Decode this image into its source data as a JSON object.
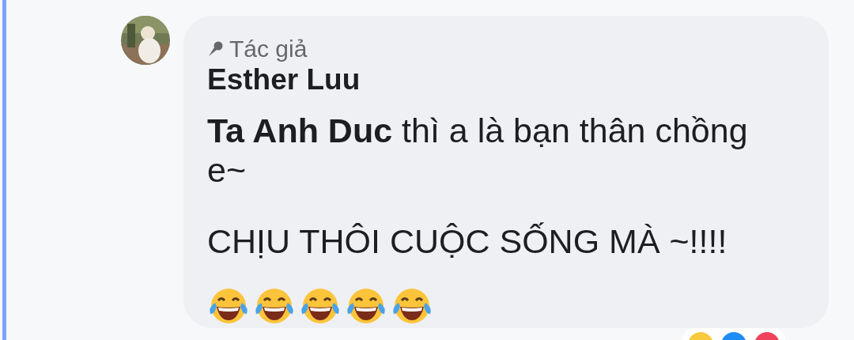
{
  "comment": {
    "author_badge": "Tác giả",
    "author": "Esther Luu",
    "paragraphs": [
      "**Ta Anh Duc**  thì a là bạn thân chồng e~",
      "CHỊU THÔI CUỘC SỐNG MÀ ~!!!!"
    ],
    "emojis": [
      {
        "kind": "tears_of_joy"
      },
      {
        "kind": "tears_of_joy"
      },
      {
        "kind": "tears_of_joy"
      },
      {
        "kind": "tears_of_joy"
      },
      {
        "kind": "tears_of_joy"
      }
    ],
    "reactions": [
      {
        "color": "#f7c93c"
      },
      {
        "color": "#1e8cf5"
      },
      {
        "color": "#f0425a"
      }
    ]
  }
}
